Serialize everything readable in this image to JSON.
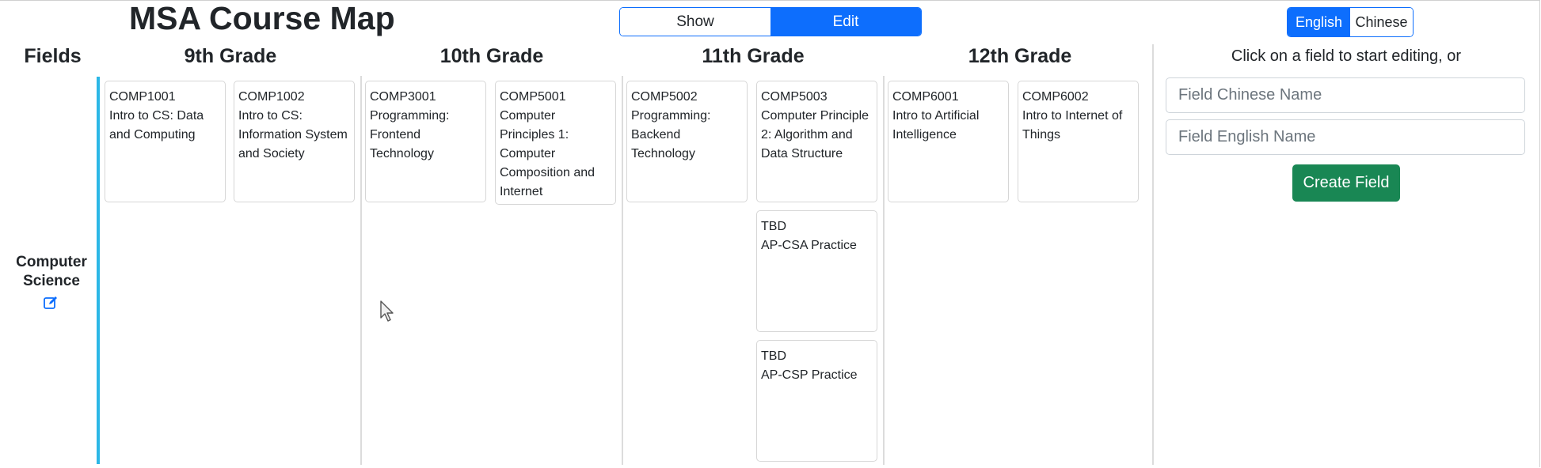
{
  "header": {
    "title": "MSA Course Map",
    "mode_show": "Show",
    "mode_edit": "Edit",
    "lang_english": "English",
    "lang_chinese": "Chinese"
  },
  "columns": {
    "fields": "Fields",
    "grade9": "9th Grade",
    "grade10": "10th Grade",
    "grade11": "11th Grade",
    "grade12": "12th Grade"
  },
  "field": {
    "name_line1": "Computer",
    "name_line2": "Science"
  },
  "courses": [
    {
      "code": "COMP1001",
      "name": "Intro to CS: Data and Computing"
    },
    {
      "code": "COMP1002",
      "name": "Intro to CS: Information System and Society"
    },
    {
      "code": "COMP3001",
      "name": "Programming: Frontend Technology"
    },
    {
      "code": "COMP5001",
      "name": "Computer Principles 1: Computer Composition and Internet"
    },
    {
      "code": "COMP5002",
      "name": "Programming: Backend Technology"
    },
    {
      "code": "COMP5003",
      "name": "Computer Principle 2: Algorithm and Data Structure"
    },
    {
      "code": "TBD",
      "name": "AP-CSA Practice"
    },
    {
      "code": "TBD",
      "name": "AP-CSP Practice"
    },
    {
      "code": "COMP6001",
      "name": "Intro to Artificial Intelligence"
    },
    {
      "code": "COMP6002",
      "name": "Intro to Internet of Things"
    }
  ],
  "panel": {
    "prompt": "Click on a field to start editing, or",
    "chinese_placeholder": "Field Chinese Name",
    "english_placeholder": "Field English Name",
    "chinese_value": "",
    "english_value": "",
    "create_label": "Create Field"
  },
  "colors": {
    "primary": "#0d6efd",
    "success": "#198754",
    "field_accent": "#2bb7e6"
  },
  "icons": {
    "edit": "edit-icon",
    "cursor": "mouse-pointer-icon"
  }
}
